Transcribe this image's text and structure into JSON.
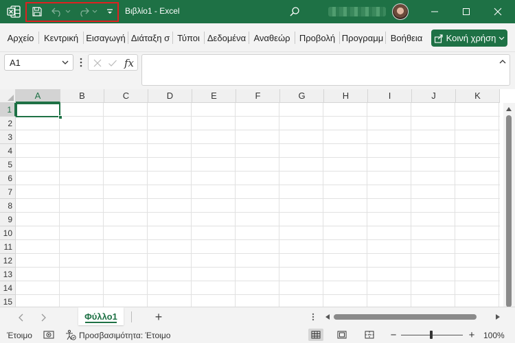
{
  "titlebar": {
    "doc_title": "Βιβλίο1  -  Excel",
    "qat_highlight_color": "#e02020",
    "icons": [
      "excel-logo",
      "save-icon",
      "undo-icon",
      "redo-icon",
      "customize-qat-icon",
      "search-icon",
      "minimize-icon",
      "maximize-icon",
      "close-icon"
    ]
  },
  "ribbon": {
    "tabs": [
      "Αρχείο",
      "Κεντρική",
      "Εισαγωγή",
      "Διάταξη σ",
      "Τύποι",
      "Δεδομένα",
      "Αναθεώρ",
      "Προβολή",
      "Προγραμμ",
      "Βοήθεια"
    ],
    "share_label": "Κοινή χρήση"
  },
  "formula_bar": {
    "name_box": "A1",
    "fx_label": "fx",
    "value": ""
  },
  "grid": {
    "columns": [
      "A",
      "B",
      "C",
      "D",
      "E",
      "F",
      "G",
      "H",
      "I",
      "J",
      "K"
    ],
    "rows": [
      "1",
      "2",
      "3",
      "4",
      "5",
      "6",
      "7",
      "8",
      "9",
      "10",
      "11",
      "12",
      "13",
      "14",
      "15"
    ],
    "active_cell": "A1"
  },
  "sheets": {
    "tabs": [
      "Φύλλο1"
    ],
    "add_label": "+"
  },
  "statusbar": {
    "ready": "Έτοιμο",
    "accessibility": "Προσβασιμότητα: Έτοιμο",
    "zoom": "100%",
    "zoom_minus": "−",
    "zoom_plus": "+"
  },
  "colors": {
    "brand": "#1e7145",
    "grid_line": "#e1e1e1",
    "header_bg": "#f0f0f0"
  }
}
